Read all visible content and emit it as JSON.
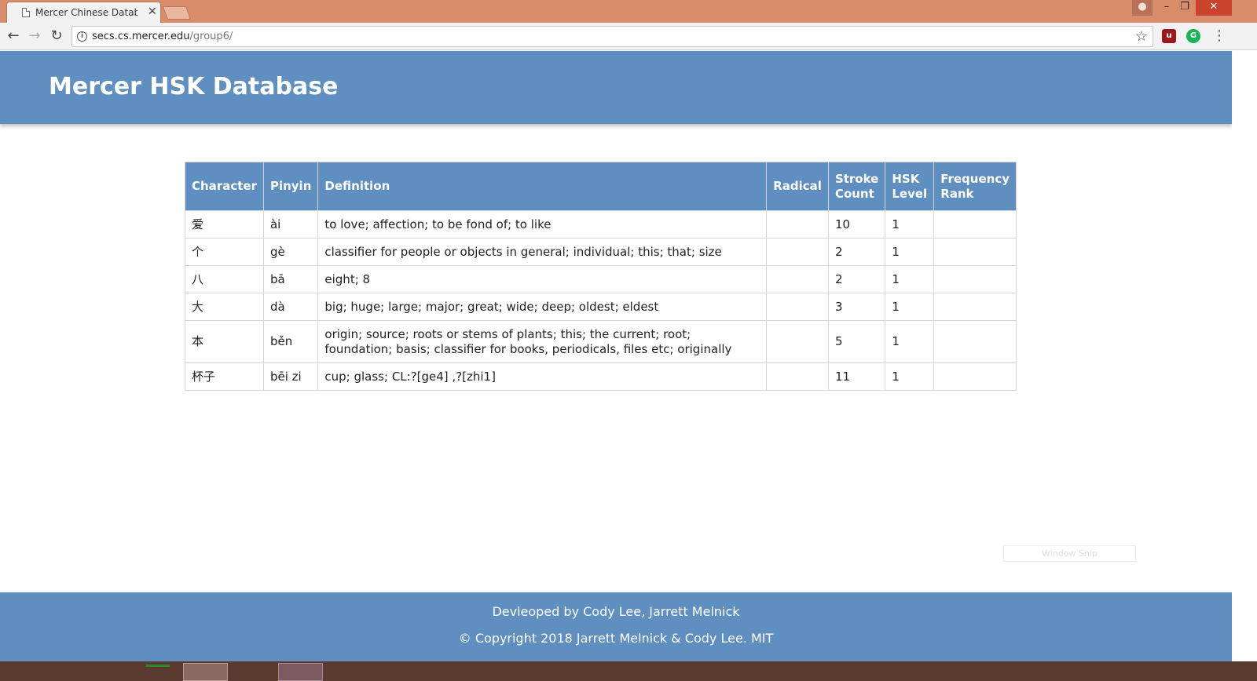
{
  "browser": {
    "tab_title": "Mercer Chinese Database",
    "url_host": "secs.cs.mercer.edu",
    "url_path": "/group6/",
    "icons": [
      "page-icon",
      "close-icon",
      "back-arrow-icon",
      "forward-arrow-icon",
      "reload-icon",
      "info-icon",
      "star-icon",
      "ublock-icon",
      "grammarly-icon",
      "menu-icon",
      "user-icon",
      "minimize-icon",
      "maximize-icon",
      "window-close-icon"
    ]
  },
  "header": {
    "title": "Mercer HSK Database",
    "color": "#5f8fc0"
  },
  "table": {
    "columns": [
      "Character",
      "Pinyin",
      "Definition",
      "Radical",
      "Stroke\nCount",
      "HSK\nLevel",
      "Frequency\nRank"
    ],
    "rows": [
      {
        "character": "爱",
        "pinyin": "ài",
        "definition": "to love; affection; to be fond of; to like",
        "radical": "",
        "strokes": "10",
        "hsk": "1",
        "rank": ""
      },
      {
        "character": "个",
        "pinyin": "gè",
        "definition": "classifier for people or objects in general; individual; this; that; size",
        "radical": "",
        "strokes": "2",
        "hsk": "1",
        "rank": ""
      },
      {
        "character": "八",
        "pinyin": "bā",
        "definition": "eight; 8",
        "radical": "",
        "strokes": "2",
        "hsk": "1",
        "rank": ""
      },
      {
        "character": "大",
        "pinyin": "dà",
        "definition": "big; huge; large; major; great; wide; deep; oldest; eldest",
        "radical": "",
        "strokes": "3",
        "hsk": "1",
        "rank": ""
      },
      {
        "character": "本",
        "pinyin": "běn",
        "definition": "origin; source; roots or stems of plants; this; the current; root; foundation; basis; classifier for books, periodicals, files etc; originally",
        "radical": "",
        "strokes": "5",
        "hsk": "1",
        "rank": ""
      },
      {
        "character": "杯子",
        "pinyin": "bēi zi",
        "definition": "cup; glass; CL:?[ge4] ,?[zhi1]",
        "radical": "",
        "strokes": "11",
        "hsk": "1",
        "rank": ""
      }
    ]
  },
  "overlay": {
    "snip_label": "Window Snip"
  },
  "footer": {
    "line1": "Devleoped by Cody Lee, Jarrett Melnick",
    "line2": "© Copyright 2018 Jarrett Melnick & Cody Lee. MIT"
  }
}
